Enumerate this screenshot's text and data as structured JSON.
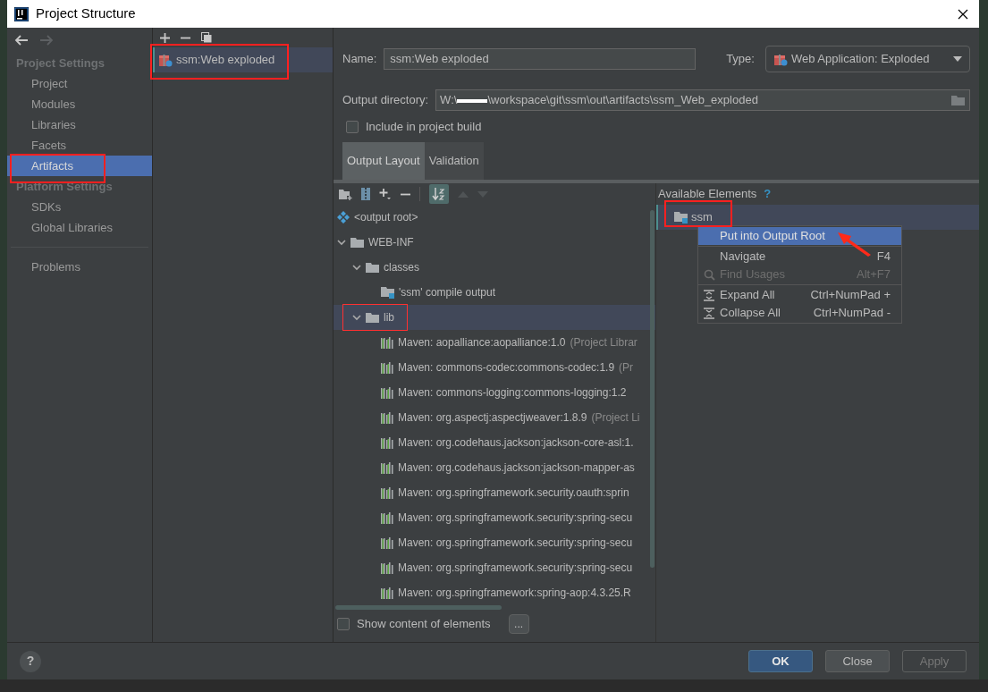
{
  "window": {
    "title": "Project Structure"
  },
  "sidebar": {
    "sections": [
      {
        "heading": "Project Settings",
        "items": [
          {
            "label": "Project",
            "selected": false
          },
          {
            "label": "Modules",
            "selected": false
          },
          {
            "label": "Libraries",
            "selected": false
          },
          {
            "label": "Facets",
            "selected": false
          },
          {
            "label": "Artifacts",
            "selected": true
          }
        ]
      },
      {
        "heading": "Platform Settings",
        "items": [
          {
            "label": "SDKs",
            "selected": false
          },
          {
            "label": "Global Libraries",
            "selected": false
          }
        ]
      }
    ],
    "problems": "Problems"
  },
  "artifact_list": {
    "items": [
      {
        "label": "ssm:Web exploded",
        "selected": true
      }
    ]
  },
  "name_field": {
    "label": "Name:",
    "value": "ssm:Web exploded"
  },
  "type_field": {
    "label": "Type:",
    "value": "Web Application: Exploded"
  },
  "output_directory": {
    "label": "Output directory:",
    "value_start": "W:\\",
    "value_end": "\\workspace\\git\\ssm\\out\\artifacts\\ssm_Web_exploded"
  },
  "include_in_build": {
    "label": "Include in project build",
    "checked": false
  },
  "tabs": [
    {
      "label": "Output Layout",
      "selected": true
    },
    {
      "label": "Validation",
      "selected": false
    }
  ],
  "layout_tree": [
    {
      "label": "<output root>",
      "kind": "root",
      "selected": false
    },
    {
      "label": "WEB-INF",
      "kind": "folder",
      "expanded": true,
      "selected": false,
      "children": [
        {
          "label": "classes",
          "kind": "folder",
          "expanded": true,
          "selected": false,
          "children": [
            {
              "label": "'ssm' compile output",
              "kind": "module_output",
              "selected": false
            }
          ]
        },
        {
          "label": "lib",
          "kind": "folder",
          "expanded": true,
          "selected": true,
          "children": [
            {
              "label": "Maven: aopalliance:aopalliance:1.0",
              "note": "(Project Librar",
              "kind": "library",
              "selected": false
            },
            {
              "label": "Maven: commons-codec:commons-codec:1.9",
              "note": "(Pr",
              "kind": "library",
              "selected": false
            },
            {
              "label": "Maven: commons-logging:commons-logging:1.2",
              "kind": "library",
              "selected": false
            },
            {
              "label": "Maven: org.aspectj:aspectjweaver:1.8.9",
              "note": "(Project Li",
              "kind": "library",
              "selected": false
            },
            {
              "label": "Maven: org.codehaus.jackson:jackson-core-asl:1.",
              "kind": "library",
              "selected": false
            },
            {
              "label": "Maven: org.codehaus.jackson:jackson-mapper-as",
              "kind": "library",
              "selected": false
            },
            {
              "label": "Maven: org.springframework.security.oauth:sprin",
              "kind": "library",
              "selected": false
            },
            {
              "label": "Maven: org.springframework.security:spring-secu",
              "kind": "library",
              "selected": false
            },
            {
              "label": "Maven: org.springframework.security:spring-secu",
              "kind": "library",
              "selected": false
            },
            {
              "label": "Maven: org.springframework.security:spring-secu",
              "kind": "library",
              "selected": false
            },
            {
              "label": "Maven: org.springframework:spring-aop:4.3.25.R",
              "kind": "library",
              "selected": false
            }
          ]
        }
      ]
    }
  ],
  "available_elements": {
    "title": "Available Elements",
    "help": "?",
    "items": [
      {
        "label": "ssm",
        "selected": true
      }
    ]
  },
  "context_menu": [
    {
      "label": "Put into Output Root",
      "kind": "plain",
      "selected": true,
      "disabled": false
    },
    {
      "label": "Navigate",
      "shortcut": "F4",
      "kind": "plain",
      "selected": false,
      "disabled": false
    },
    {
      "label": "Find Usages",
      "shortcut": "Alt+F7",
      "kind": "search",
      "selected": false,
      "disabled": true
    },
    {
      "label": "Expand All",
      "shortcut": "Ctrl+NumPad +",
      "kind": "expand",
      "selected": false,
      "disabled": false
    },
    {
      "label": "Collapse All",
      "shortcut": "Ctrl+NumPad -",
      "kind": "collapse",
      "selected": false,
      "disabled": false
    }
  ],
  "show_content": {
    "label": "Show content of elements",
    "checked": false,
    "button": "..."
  },
  "footer": {
    "help": "?",
    "buttons": [
      {
        "label": "OK",
        "kind": "default",
        "disabled": false
      },
      {
        "label": "Close",
        "kind": "normal",
        "disabled": false
      },
      {
        "label": "Apply",
        "kind": "normal",
        "disabled": true
      }
    ]
  }
}
